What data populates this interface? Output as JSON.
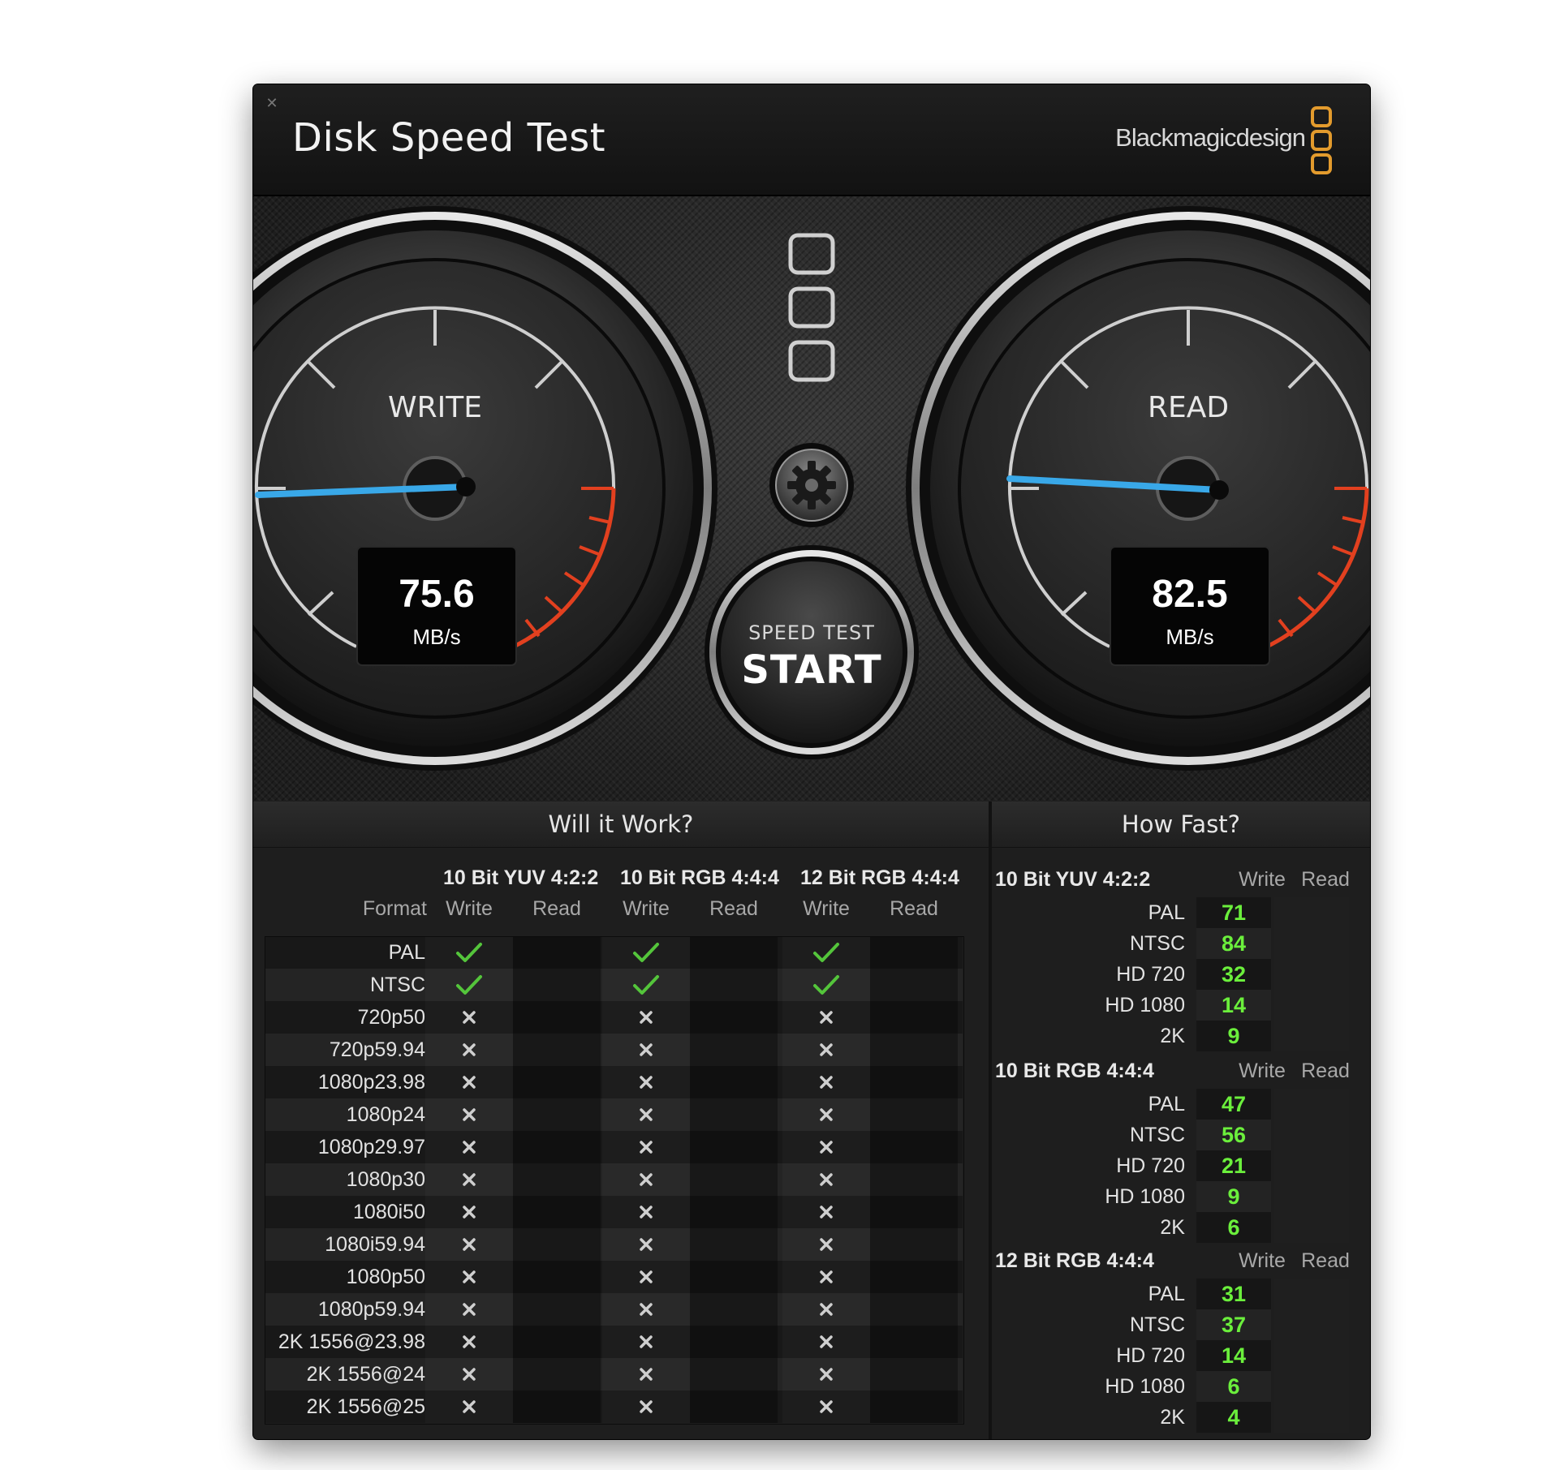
{
  "window": {
    "title": "Disk Speed Test",
    "brand": "Blackmagicdesign",
    "close_icon": "close-icon",
    "brand_accent_color": "#e39b2d"
  },
  "gauges": {
    "write": {
      "label": "WRITE",
      "value": "75.6",
      "unit": "MB/s"
    },
    "read": {
      "label": "READ",
      "value": "82.5",
      "unit": "MB/s"
    },
    "needle_color": "#39a8e8",
    "redline_color": "#e2401f"
  },
  "center_controls": {
    "settings_icon": "gear-icon",
    "start_button": {
      "top_label": "SPEED TEST",
      "main_label": "START"
    }
  },
  "will_it_work": {
    "title": "Will it Work?",
    "format_header": "Format",
    "groups": [
      {
        "name": "10 Bit YUV 4:2:2",
        "write": "Write",
        "read": "Read"
      },
      {
        "name": "10 Bit RGB 4:4:4",
        "write": "Write",
        "read": "Read"
      },
      {
        "name": "12 Bit RGB 4:4:4",
        "write": "Write",
        "read": "Read"
      }
    ],
    "rows": [
      {
        "format": "PAL",
        "results": [
          "check",
          "",
          "check",
          "",
          "check",
          ""
        ]
      },
      {
        "format": "NTSC",
        "results": [
          "check",
          "",
          "check",
          "",
          "check",
          ""
        ]
      },
      {
        "format": "720p50",
        "results": [
          "cross",
          "",
          "cross",
          "",
          "cross",
          ""
        ]
      },
      {
        "format": "720p59.94",
        "results": [
          "cross",
          "",
          "cross",
          "",
          "cross",
          ""
        ]
      },
      {
        "format": "1080p23.98",
        "results": [
          "cross",
          "",
          "cross",
          "",
          "cross",
          ""
        ]
      },
      {
        "format": "1080p24",
        "results": [
          "cross",
          "",
          "cross",
          "",
          "cross",
          ""
        ]
      },
      {
        "format": "1080p29.97",
        "results": [
          "cross",
          "",
          "cross",
          "",
          "cross",
          ""
        ]
      },
      {
        "format": "1080p30",
        "results": [
          "cross",
          "",
          "cross",
          "",
          "cross",
          ""
        ]
      },
      {
        "format": "1080i50",
        "results": [
          "cross",
          "",
          "cross",
          "",
          "cross",
          ""
        ]
      },
      {
        "format": "1080i59.94",
        "results": [
          "cross",
          "",
          "cross",
          "",
          "cross",
          ""
        ]
      },
      {
        "format": "1080p50",
        "results": [
          "cross",
          "",
          "cross",
          "",
          "cross",
          ""
        ]
      },
      {
        "format": "1080p59.94",
        "results": [
          "cross",
          "",
          "cross",
          "",
          "cross",
          ""
        ]
      },
      {
        "format": "2K 1556@23.98",
        "results": [
          "cross",
          "",
          "cross",
          "",
          "cross",
          ""
        ]
      },
      {
        "format": "2K 1556@24",
        "results": [
          "cross",
          "",
          "cross",
          "",
          "cross",
          ""
        ]
      },
      {
        "format": "2K 1556@25",
        "results": [
          "cross",
          "",
          "cross",
          "",
          "cross",
          ""
        ]
      }
    ],
    "check_color": "#54c53b",
    "cross_color": "#cfcfcf"
  },
  "how_fast": {
    "title": "How Fast?",
    "value_color": "#6bef3c",
    "groups": [
      {
        "name": "10 Bit YUV 4:2:2",
        "write": "Write",
        "read": "Read",
        "rows": [
          {
            "label": "PAL",
            "write": "71",
            "read": ""
          },
          {
            "label": "NTSC",
            "write": "84",
            "read": ""
          },
          {
            "label": "HD 720",
            "write": "32",
            "read": ""
          },
          {
            "label": "HD 1080",
            "write": "14",
            "read": ""
          },
          {
            "label": "2K",
            "write": "9",
            "read": ""
          }
        ]
      },
      {
        "name": "10 Bit RGB 4:4:4",
        "write": "Write",
        "read": "Read",
        "rows": [
          {
            "label": "PAL",
            "write": "47",
            "read": ""
          },
          {
            "label": "NTSC",
            "write": "56",
            "read": ""
          },
          {
            "label": "HD 720",
            "write": "21",
            "read": ""
          },
          {
            "label": "HD 1080",
            "write": "9",
            "read": ""
          },
          {
            "label": "2K",
            "write": "6",
            "read": ""
          }
        ]
      },
      {
        "name": "12 Bit RGB 4:4:4",
        "write": "Write",
        "read": "Read",
        "rows": [
          {
            "label": "PAL",
            "write": "31",
            "read": ""
          },
          {
            "label": "NTSC",
            "write": "37",
            "read": ""
          },
          {
            "label": "HD 720",
            "write": "14",
            "read": ""
          },
          {
            "label": "HD 1080",
            "write": "6",
            "read": ""
          },
          {
            "label": "2K",
            "write": "4",
            "read": ""
          }
        ]
      }
    ]
  }
}
